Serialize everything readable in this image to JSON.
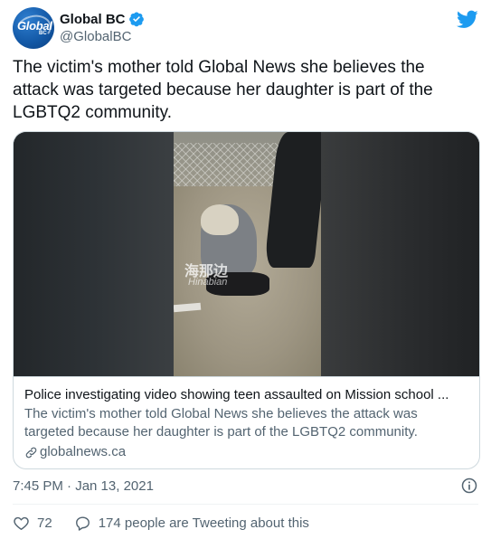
{
  "author": {
    "display_name": "Global BC",
    "handle": "@GlobalBC",
    "avatar_text": "Global",
    "avatar_sub": "BC",
    "verified": true
  },
  "tweet": {
    "text": "The victim's mother told Global News she believes the attack was targeted because her daughter is part of the LGBTQ2 community.",
    "timestamp": "7:45 PM · Jan 13, 2021"
  },
  "card": {
    "title": "Police investigating video showing teen assaulted on Mission school ...",
    "description": "The victim's mother told Global News she believes the attack was targeted because her daughter is part of the LGBTQ2 community.",
    "domain": "globalnews.ca",
    "watermark": "海那边",
    "watermark_sub": "Hinabian"
  },
  "actions": {
    "like_count": "72",
    "conversation_text": "174 people are Tweeting about this"
  },
  "colors": {
    "text_primary": "#0f1419",
    "text_secondary": "#536471",
    "twitter_blue": "#1d9bf0",
    "border": "#cfd9de",
    "avatar_blue": "#145aa8"
  },
  "icons": [
    "verified-badge-icon",
    "twitter-bird-icon",
    "link-icon",
    "info-icon",
    "heart-icon",
    "speech-bubble-icon"
  ]
}
